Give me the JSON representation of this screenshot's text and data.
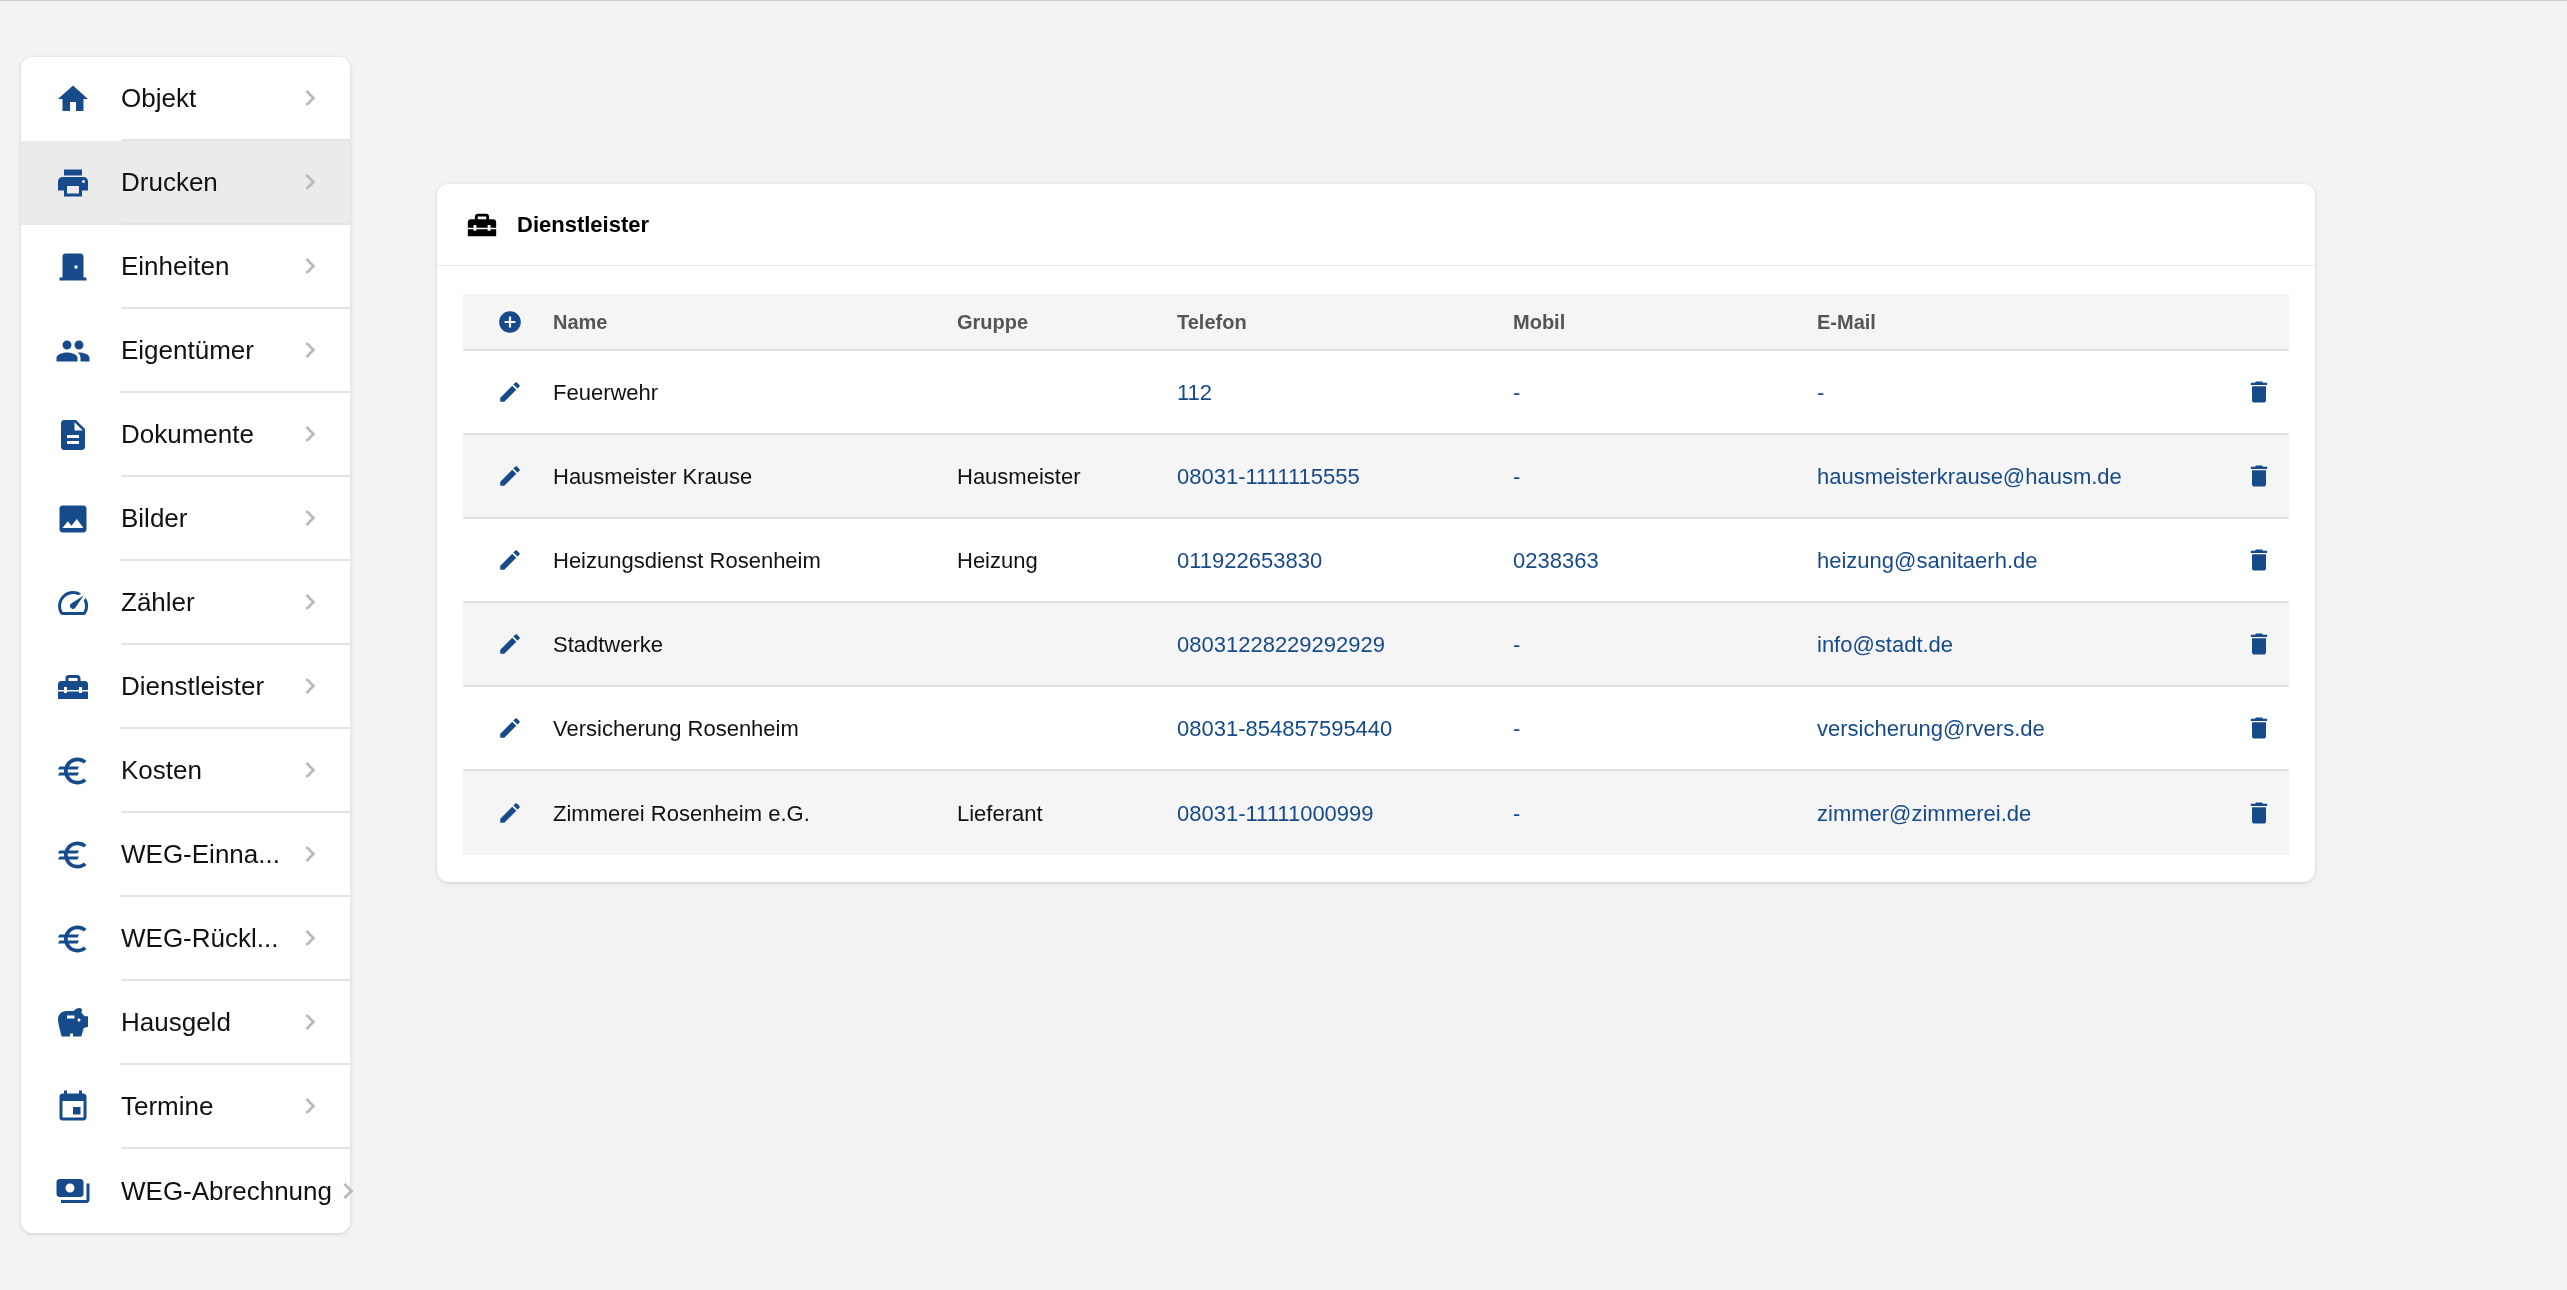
{
  "sidebar": {
    "items": [
      {
        "label": "Objekt",
        "selected": false
      },
      {
        "label": "Drucken",
        "selected": true
      },
      {
        "label": "Einheiten",
        "selected": false
      },
      {
        "label": "Eigentümer",
        "selected": false
      },
      {
        "label": "Dokumente",
        "selected": false
      },
      {
        "label": "Bilder",
        "selected": false
      },
      {
        "label": "Zähler",
        "selected": false
      },
      {
        "label": "Dienstleister",
        "selected": false
      },
      {
        "label": "Kosten",
        "selected": false
      },
      {
        "label": "WEG-Einna...",
        "selected": false
      },
      {
        "label": "WEG-Rückl...",
        "selected": false
      },
      {
        "label": "Hausgeld",
        "selected": false
      },
      {
        "label": "Termine",
        "selected": false
      },
      {
        "label": "WEG-Abrechnung",
        "selected": false
      }
    ]
  },
  "card": {
    "title": "Dienstleister",
    "table": {
      "columns": [
        "Name",
        "Gruppe",
        "Telefon",
        "Mobil",
        "E-Mail"
      ],
      "rows": [
        {
          "name": "Feuerwehr",
          "gruppe": "",
          "telefon": "112",
          "mobil": "-",
          "email": "-"
        },
        {
          "name": "Hausmeister Krause",
          "gruppe": "Hausmeister",
          "telefon": "08031-1111115555",
          "mobil": "-",
          "email": "hausmeisterkrause@hausm.de"
        },
        {
          "name": "Heizungsdienst Rosenheim",
          "gruppe": "Heizung",
          "telefon": "011922653830",
          "mobil": "0238363",
          "email": "heizung@sanitaerh.de"
        },
        {
          "name": "Stadtwerke",
          "gruppe": "",
          "telefon": "08031228229292929",
          "mobil": "-",
          "email": "info@stadt.de"
        },
        {
          "name": "Versicherung Rosenheim",
          "gruppe": "",
          "telefon": "08031-854857595440",
          "mobil": "-",
          "email": "versicherung@rvers.de"
        },
        {
          "name": "Zimmerei Rosenheim e.G.",
          "gruppe": "Lieferant",
          "telefon": "08031-11111000999",
          "mobil": "-",
          "email": "zimmer@zimmerei.de"
        }
      ]
    }
  }
}
